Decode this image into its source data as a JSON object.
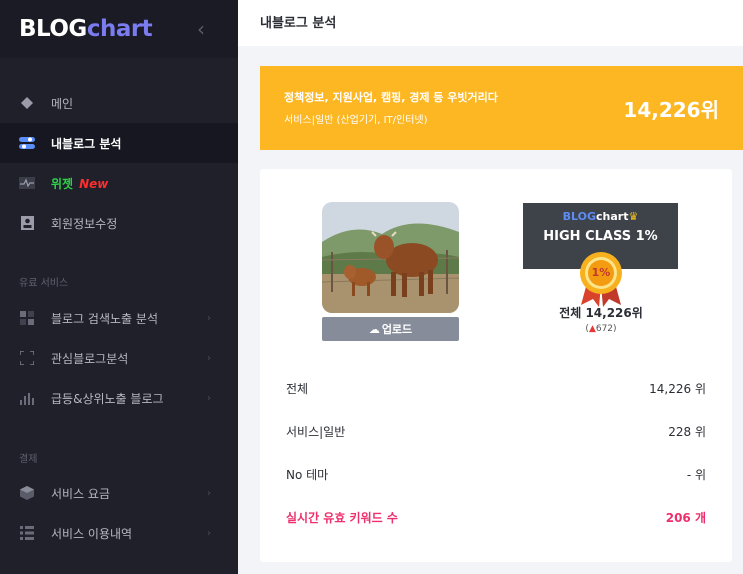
{
  "logo": {
    "part1": "BLOG",
    "part2": "chart"
  },
  "sidebar": {
    "items": [
      {
        "label": "메인",
        "icon": "diamond-icon"
      },
      {
        "label": "내블로그 분석",
        "icon": "toggle-icon",
        "active": true
      },
      {
        "label": "위젯",
        "badge": "New",
        "icon": "pulse-icon"
      },
      {
        "label": "회원정보수정",
        "icon": "person-card-icon"
      }
    ],
    "paid_section": "유료 서비스",
    "paid_items": [
      {
        "label": "블로그 검색노출 분석",
        "icon": "grid-icon"
      },
      {
        "label": "관심블로그분석",
        "icon": "frame-icon"
      },
      {
        "label": "급등&상위노출 블로그",
        "icon": "bar-chart-icon"
      }
    ],
    "pay_section": "결제",
    "pay_items": [
      {
        "label": "서비스 요금",
        "icon": "cube-icon"
      },
      {
        "label": "서비스 이용내역",
        "icon": "list-icon"
      }
    ]
  },
  "header": {
    "title": "내블로그 분석"
  },
  "banner": {
    "title": "정책정보, 지원사업, 캠핑, 경제 등 우빗거리다",
    "category": "서비스|일반 (산업기기, IT/인터넷)",
    "rank": "14,226위",
    "color": "#fdb723"
  },
  "profile": {
    "upload_label": "업로드"
  },
  "class_badge": {
    "logo_part1": "BLOG",
    "logo_part2": "chart",
    "title": "HIGH CLASS 1%",
    "medal_text": "1%"
  },
  "rank": {
    "total": "전체 14,226위",
    "change": "672"
  },
  "stats": [
    {
      "label": "전체",
      "value": "14,226 위"
    },
    {
      "label": "서비스|일반",
      "value": "228 위"
    },
    {
      "label": "No 테마",
      "value": "- 위"
    },
    {
      "label": "실시간 유효 키워드 수",
      "value": "206 개",
      "highlight": true
    }
  ],
  "colors": {
    "sidebar_bg": "#1f2029",
    "accent_pink": "#ef2f6d",
    "logo_accent": "#7a7cf0"
  }
}
